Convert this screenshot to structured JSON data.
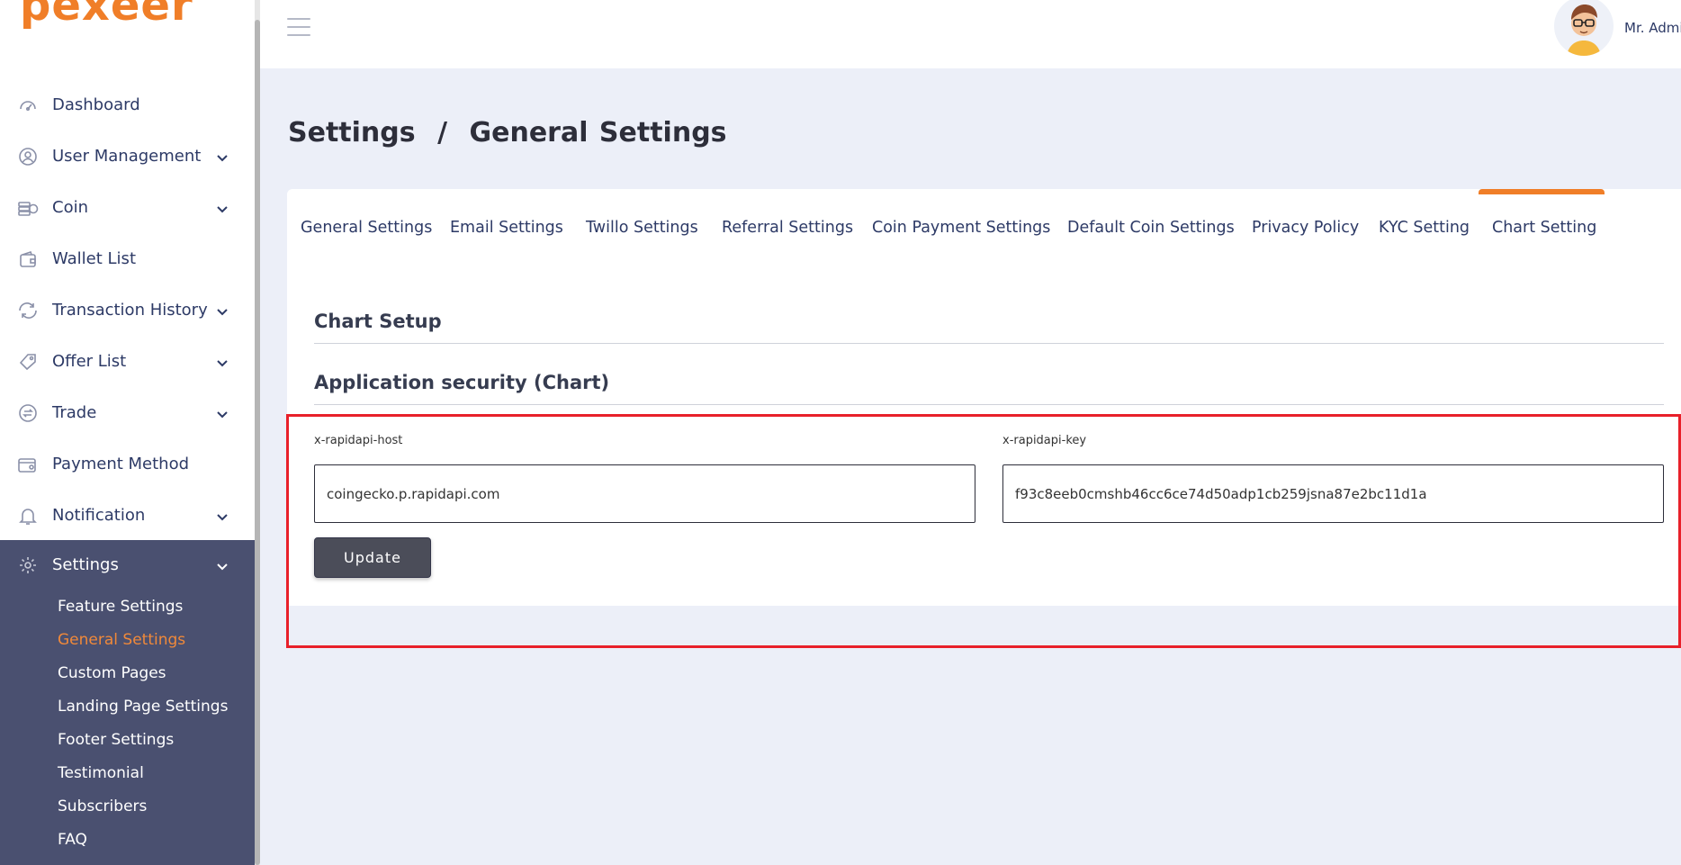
{
  "brand": {
    "logo_text": "pexeer",
    "accent_color": "#f07e28"
  },
  "sidebar": {
    "items": [
      {
        "label": "Dashboard",
        "icon": "dashboard-icon",
        "has_submenu": false
      },
      {
        "label": "User Management",
        "icon": "user-icon",
        "has_submenu": true
      },
      {
        "label": "Coin",
        "icon": "coin-icon",
        "has_submenu": true
      },
      {
        "label": "Wallet List",
        "icon": "wallet-icon",
        "has_submenu": false
      },
      {
        "label": "Transaction History",
        "icon": "transaction-icon",
        "has_submenu": true
      },
      {
        "label": "Offer List",
        "icon": "offer-icon",
        "has_submenu": true
      },
      {
        "label": "Trade",
        "icon": "trade-icon",
        "has_submenu": true
      },
      {
        "label": "Payment Method",
        "icon": "payment-icon",
        "has_submenu": false
      },
      {
        "label": "Notification",
        "icon": "bell-icon",
        "has_submenu": true
      }
    ],
    "settings": {
      "label": "Settings",
      "icon": "gear-icon",
      "sub_items": [
        {
          "label": "Feature Settings",
          "active": false
        },
        {
          "label": "General Settings",
          "active": true
        },
        {
          "label": "Custom Pages",
          "active": false
        },
        {
          "label": "Landing Page Settings",
          "active": false
        },
        {
          "label": "Footer Settings",
          "active": false
        },
        {
          "label": "Testimonial",
          "active": false
        },
        {
          "label": "Subscribers",
          "active": false
        },
        {
          "label": "FAQ",
          "active": false
        }
      ]
    }
  },
  "header": {
    "user_name": "Mr. Admi"
  },
  "page": {
    "breadcrumb_root": "Settings",
    "breadcrumb_sep": "/",
    "breadcrumb_current": "General Settings"
  },
  "tabs": [
    {
      "label": "General Settings",
      "active": false
    },
    {
      "label": "Email Settings",
      "active": false
    },
    {
      "label": "Twillo Settings",
      "active": false
    },
    {
      "label": "Referral Settings",
      "active": false
    },
    {
      "label": "Coin Payment Settings",
      "active": false
    },
    {
      "label": "Default Coin Settings",
      "active": false
    },
    {
      "label": "Privacy Policy",
      "active": false
    },
    {
      "label": "KYC Setting",
      "active": false
    },
    {
      "label": "Chart Setting",
      "active": true
    }
  ],
  "chart_setup": {
    "title": "Chart Setup",
    "subtitle": "Application security (Chart)",
    "host_label": "x-rapidapi-host",
    "host_value": "coingecko.p.rapidapi.com",
    "key_label": "x-rapidapi-key",
    "key_value": "f93c8eeb0cmshb46cc6ce74d50adp1cb259jsna87e2bc11d1a",
    "update_label": "Update"
  }
}
